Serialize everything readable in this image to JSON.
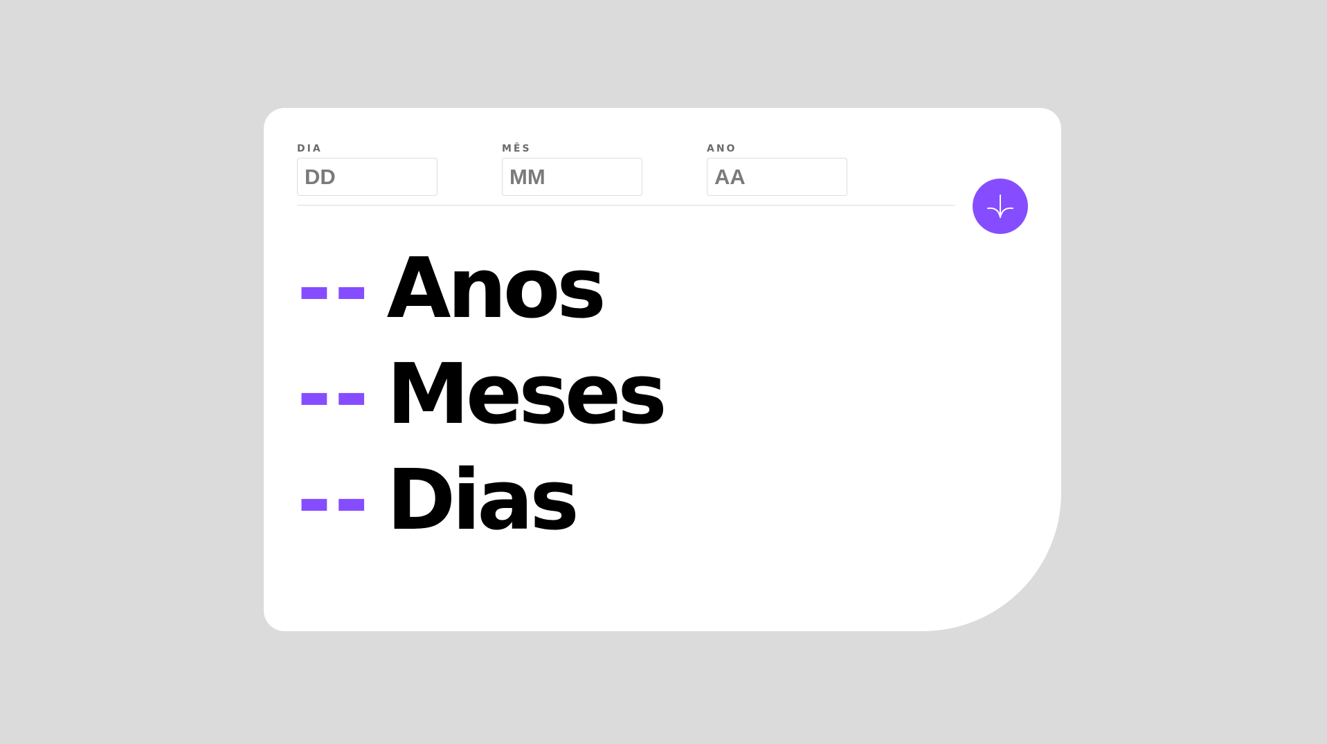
{
  "colors": {
    "accent": "#854dff",
    "background": "#dbdbdb",
    "card": "#ffffff",
    "text": "#000000",
    "label": "#6b6b6b"
  },
  "form": {
    "day": {
      "label": "DIA",
      "placeholder": "DD",
      "value": ""
    },
    "month": {
      "label": "MÊS",
      "placeholder": "MM",
      "value": ""
    },
    "year": {
      "label": "ANO",
      "placeholder": "AA",
      "value": ""
    }
  },
  "submit": {
    "icon": "arrow-down-icon"
  },
  "results": {
    "years": {
      "value": "--",
      "unit": "Anos"
    },
    "months": {
      "value": "--",
      "unit": "Meses"
    },
    "days": {
      "value": "--",
      "unit": "Dias"
    }
  }
}
